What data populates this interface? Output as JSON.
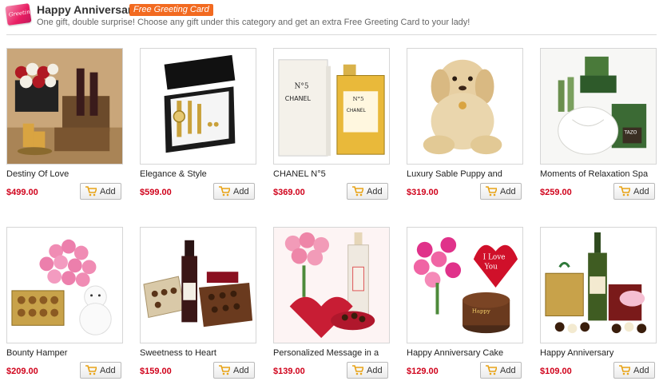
{
  "header": {
    "logo_text": "Greeting",
    "title": "Happy Anniversary",
    "badge": "Free Greeting Card",
    "subtitle": "One gift, double surprise! Choose any gift under this category and get an extra Free Greeting Card to your lady!"
  },
  "add_label": "Add",
  "colors": {
    "price": "#d0021b",
    "badge": "#f26a20",
    "cart_icon": "#e8a317"
  },
  "products": [
    {
      "name": "Destiny Of Love",
      "price": "$499.00",
      "image": "roses-wine-hamper-photo"
    },
    {
      "name": "Elegance & Style",
      "price": "$599.00",
      "image": "gold-watch-box-photo"
    },
    {
      "name": "CHANEL N°5",
      "price": "$369.00",
      "image": "chanel-perfume-photo"
    },
    {
      "name": "Luxury Sable Puppy and",
      "price": "$319.00",
      "image": "plush-puppy-photo"
    },
    {
      "name": "Moments of Relaxation Spa",
      "price": "$259.00",
      "image": "spa-basket-photo"
    },
    {
      "name": "Bounty Hamper",
      "price": "$209.00",
      "image": "pink-roses-teddy-photo"
    },
    {
      "name": "Sweetness to Heart",
      "price": "$159.00",
      "image": "wine-chocolates-photo"
    },
    {
      "name": "Personalized Message in a",
      "price": "$139.00",
      "image": "message-bottle-roses-photo"
    },
    {
      "name": "Happy Anniversary Cake",
      "price": "$129.00",
      "image": "lilies-balloon-cake-photo"
    },
    {
      "name": "Happy Anniversary",
      "price": "$109.00",
      "image": "champagne-chocolates-photo"
    }
  ]
}
